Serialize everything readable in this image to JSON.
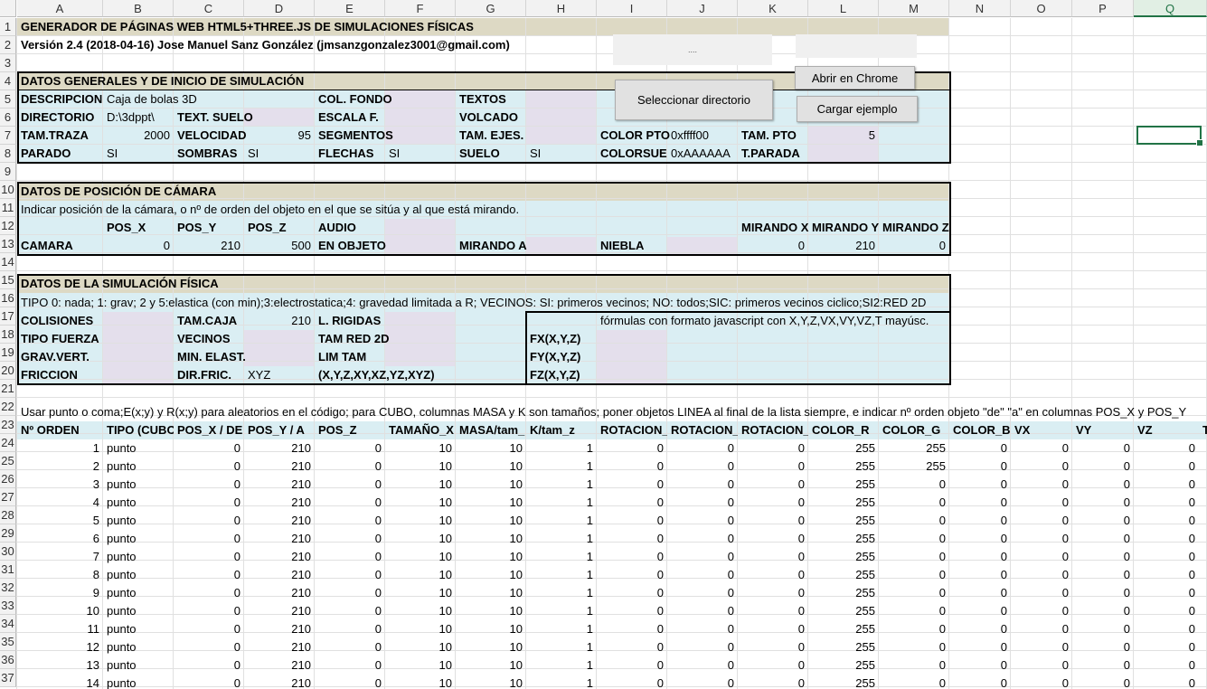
{
  "sheet": {
    "columns": [
      "A",
      "B",
      "C",
      "D",
      "E",
      "F",
      "G",
      "H",
      "I",
      "J",
      "K",
      "L",
      "M",
      "N",
      "O",
      "P",
      "Q"
    ],
    "selected_column": "Q",
    "rows": [
      "1",
      "2",
      "3",
      "4",
      "5",
      "6",
      "7",
      "8",
      "9",
      "10",
      "11",
      "12",
      "13",
      "14",
      "15",
      "16",
      "17",
      "18",
      "19",
      "20",
      "21",
      "22",
      "23",
      "24",
      "25",
      "26",
      "27",
      "28",
      "29",
      "30",
      "31",
      "32",
      "33",
      "34",
      "35",
      "36",
      "37"
    ]
  },
  "colors": {
    "header_tan": "#ddd9c4",
    "section_blue": "#daeef3",
    "input_lilac": "#e4dfec",
    "selection": "#217346"
  },
  "header": {
    "title": "GENERADOR DE PÁGINAS WEB HTML5+THREE.JS DE SIMULACIONES FÍSICAS",
    "version": "Versión 2.4 (2018-04-16) Jose Manuel Sanz González (jmsanzgonzalez3001@gmail.com)",
    "ellipsis": "...."
  },
  "buttons": {
    "abrir": "Abrir en Chrome",
    "seleccionar": "Seleccionar directorio",
    "cargar": "Cargar ejemplo"
  },
  "general": {
    "title": "DATOS GENERALES Y DE INICIO DE SIMULACIÓN",
    "descripcion_label": "DESCRIPCION",
    "descripcion_value": "Caja de bolas 3D",
    "col_fondo": "COL. FONDO",
    "textos": "TEXTOS",
    "directorio_label": "DIRECTORIO",
    "directorio_value": "D:\\3dppt\\",
    "text_suelo": "TEXT. SUELO",
    "escala": "ESCALA F.",
    "volcado": "VOLCADO",
    "tam_traza_label": "TAM.TRAZA",
    "tam_traza_value": "2000",
    "velocidad_label": "VELOCIDAD",
    "velocidad_value": "95",
    "segmentos": "SEGMENTOS",
    "tam_ejes": "TAM. EJES.",
    "color_pto_label": "COLOR PTO",
    "color_pto_value": "0xffff00",
    "tam_pto_label": "TAM. PTO",
    "tam_pto_value": "5",
    "parado_label": "PARADO",
    "parado_value": "SI",
    "sombras_label": "SOMBRAS",
    "sombras_value": "SI",
    "flechas_label": "FLECHAS",
    "flechas_value": "SI",
    "suelo_label": "SUELO",
    "suelo_value": "SI",
    "colorsuelo_label": "COLORSUELO",
    "colorsuelo_value": "0xAAAAAA",
    "tparada": "T.PARADA"
  },
  "camera": {
    "title": "DATOS DE POSICIÓN DE CÁMARA",
    "note": "Indicar posición de la cámara, o nº de orden del objeto en el que se sitúa y al que está mirando.",
    "pos_x": "POS_X",
    "pos_y": "POS_Y",
    "pos_z": "POS_Z",
    "audio": "AUDIO",
    "mirando_x": "MIRANDO X",
    "mirando_y": "MIRANDO Y",
    "mirando_z": "MIRANDO Z",
    "camara": "CAMARA",
    "vx": "0",
    "vy": "210",
    "vz": "500",
    "en_objeto": "EN OBJETO",
    "mirando_a": "MIRANDO A",
    "niebla": "NIEBLA",
    "mx": "0",
    "my": "210",
    "mz": "0"
  },
  "physics": {
    "title": "DATOS DE LA SIMULACIÓN FÍSICA",
    "tipo_note": "TIPO 0: nada; 1: grav; 2 y 5:elastica (con min);3:electrostatica;4: gravedad limitada a R; VECINOS: SI: primeros vecinos; NO: todos;SIC: primeros vecinos ciclico;SI2:RED 2D",
    "colisiones": "COLISIONES",
    "tam_caja_label": "TAM.CAJA",
    "tam_caja_value": "210",
    "l_rigidas": "L. RIGIDAS",
    "formula_note": "fórmulas con formato javascript con X,Y,Z,VX,VY,VZ,T mayúsc.",
    "tipo_fuerza": "TIPO FUERZA",
    "vecinos": "VECINOS",
    "tam_red": "TAM RED 2D",
    "fx": "FX(X,Y,Z)",
    "grav_vert": "GRAV.VERT.",
    "min_elast": "MIN. ELAST.",
    "lim_tam": "LIM TAM",
    "fy": "FY(X,Y,Z)",
    "friccion": "FRICCION",
    "dir_fric_label": "DIR.FRIC.",
    "dir_fric_value": "XYZ",
    "dir_options": "(X,Y,Z,XY,XZ,YZ,XYZ)",
    "fz": "FZ(X,Y,Z)"
  },
  "objects": {
    "note": "Usar punto o coma;E(x;y) y R(x;y) para aleatorios en el código; para CUBO, columnas MASA y K son tamaños; poner objetos LINEA al final de la lista siempre, e indicar nº orden objeto \"de\" \"a\" en columnas POS_X y POS_Y",
    "headers": [
      "Nº ORDEN",
      "TIPO (CUBO,",
      "POS_X / DE",
      "POS_Y / A",
      "POS_Z",
      "TAMAÑO_X",
      "MASA/tam_",
      "K/tam_z",
      "ROTACION_X",
      "ROTACION_Y",
      "ROTACION_Z",
      "COLOR_R",
      "COLOR_G",
      "COLOR_B",
      "VX",
      "VY",
      "VZ",
      "T"
    ],
    "rows": [
      [
        "1",
        "punto",
        "0",
        "210",
        "0",
        "10",
        "10",
        "1",
        "0",
        "0",
        "0",
        "255",
        "255",
        "0",
        "0",
        "0",
        "0"
      ],
      [
        "2",
        "punto",
        "0",
        "210",
        "0",
        "10",
        "10",
        "1",
        "0",
        "0",
        "0",
        "255",
        "255",
        "0",
        "0",
        "0",
        "0"
      ],
      [
        "3",
        "punto",
        "0",
        "210",
        "0",
        "10",
        "10",
        "1",
        "0",
        "0",
        "0",
        "255",
        "0",
        "0",
        "0",
        "0",
        "0"
      ],
      [
        "4",
        "punto",
        "0",
        "210",
        "0",
        "10",
        "10",
        "1",
        "0",
        "0",
        "0",
        "255",
        "0",
        "0",
        "0",
        "0",
        "0"
      ],
      [
        "5",
        "punto",
        "0",
        "210",
        "0",
        "10",
        "10",
        "1",
        "0",
        "0",
        "0",
        "255",
        "0",
        "0",
        "0",
        "0",
        "0"
      ],
      [
        "6",
        "punto",
        "0",
        "210",
        "0",
        "10",
        "10",
        "1",
        "0",
        "0",
        "0",
        "255",
        "0",
        "0",
        "0",
        "0",
        "0"
      ],
      [
        "7",
        "punto",
        "0",
        "210",
        "0",
        "10",
        "10",
        "1",
        "0",
        "0",
        "0",
        "255",
        "0",
        "0",
        "0",
        "0",
        "0"
      ],
      [
        "8",
        "punto",
        "0",
        "210",
        "0",
        "10",
        "10",
        "1",
        "0",
        "0",
        "0",
        "255",
        "0",
        "0",
        "0",
        "0",
        "0"
      ],
      [
        "9",
        "punto",
        "0",
        "210",
        "0",
        "10",
        "10",
        "1",
        "0",
        "0",
        "0",
        "255",
        "0",
        "0",
        "0",
        "0",
        "0"
      ],
      [
        "10",
        "punto",
        "0",
        "210",
        "0",
        "10",
        "10",
        "1",
        "0",
        "0",
        "0",
        "255",
        "0",
        "0",
        "0",
        "0",
        "0"
      ],
      [
        "11",
        "punto",
        "0",
        "210",
        "0",
        "10",
        "10",
        "1",
        "0",
        "0",
        "0",
        "255",
        "0",
        "0",
        "0",
        "0",
        "0"
      ],
      [
        "12",
        "punto",
        "0",
        "210",
        "0",
        "10",
        "10",
        "1",
        "0",
        "0",
        "0",
        "255",
        "0",
        "0",
        "0",
        "0",
        "0"
      ],
      [
        "13",
        "punto",
        "0",
        "210",
        "0",
        "10",
        "10",
        "1",
        "0",
        "0",
        "0",
        "255",
        "0",
        "0",
        "0",
        "0",
        "0"
      ],
      [
        "14",
        "punto",
        "0",
        "210",
        "0",
        "10",
        "10",
        "1",
        "0",
        "0",
        "0",
        "255",
        "0",
        "0",
        "0",
        "0",
        "0"
      ]
    ]
  }
}
